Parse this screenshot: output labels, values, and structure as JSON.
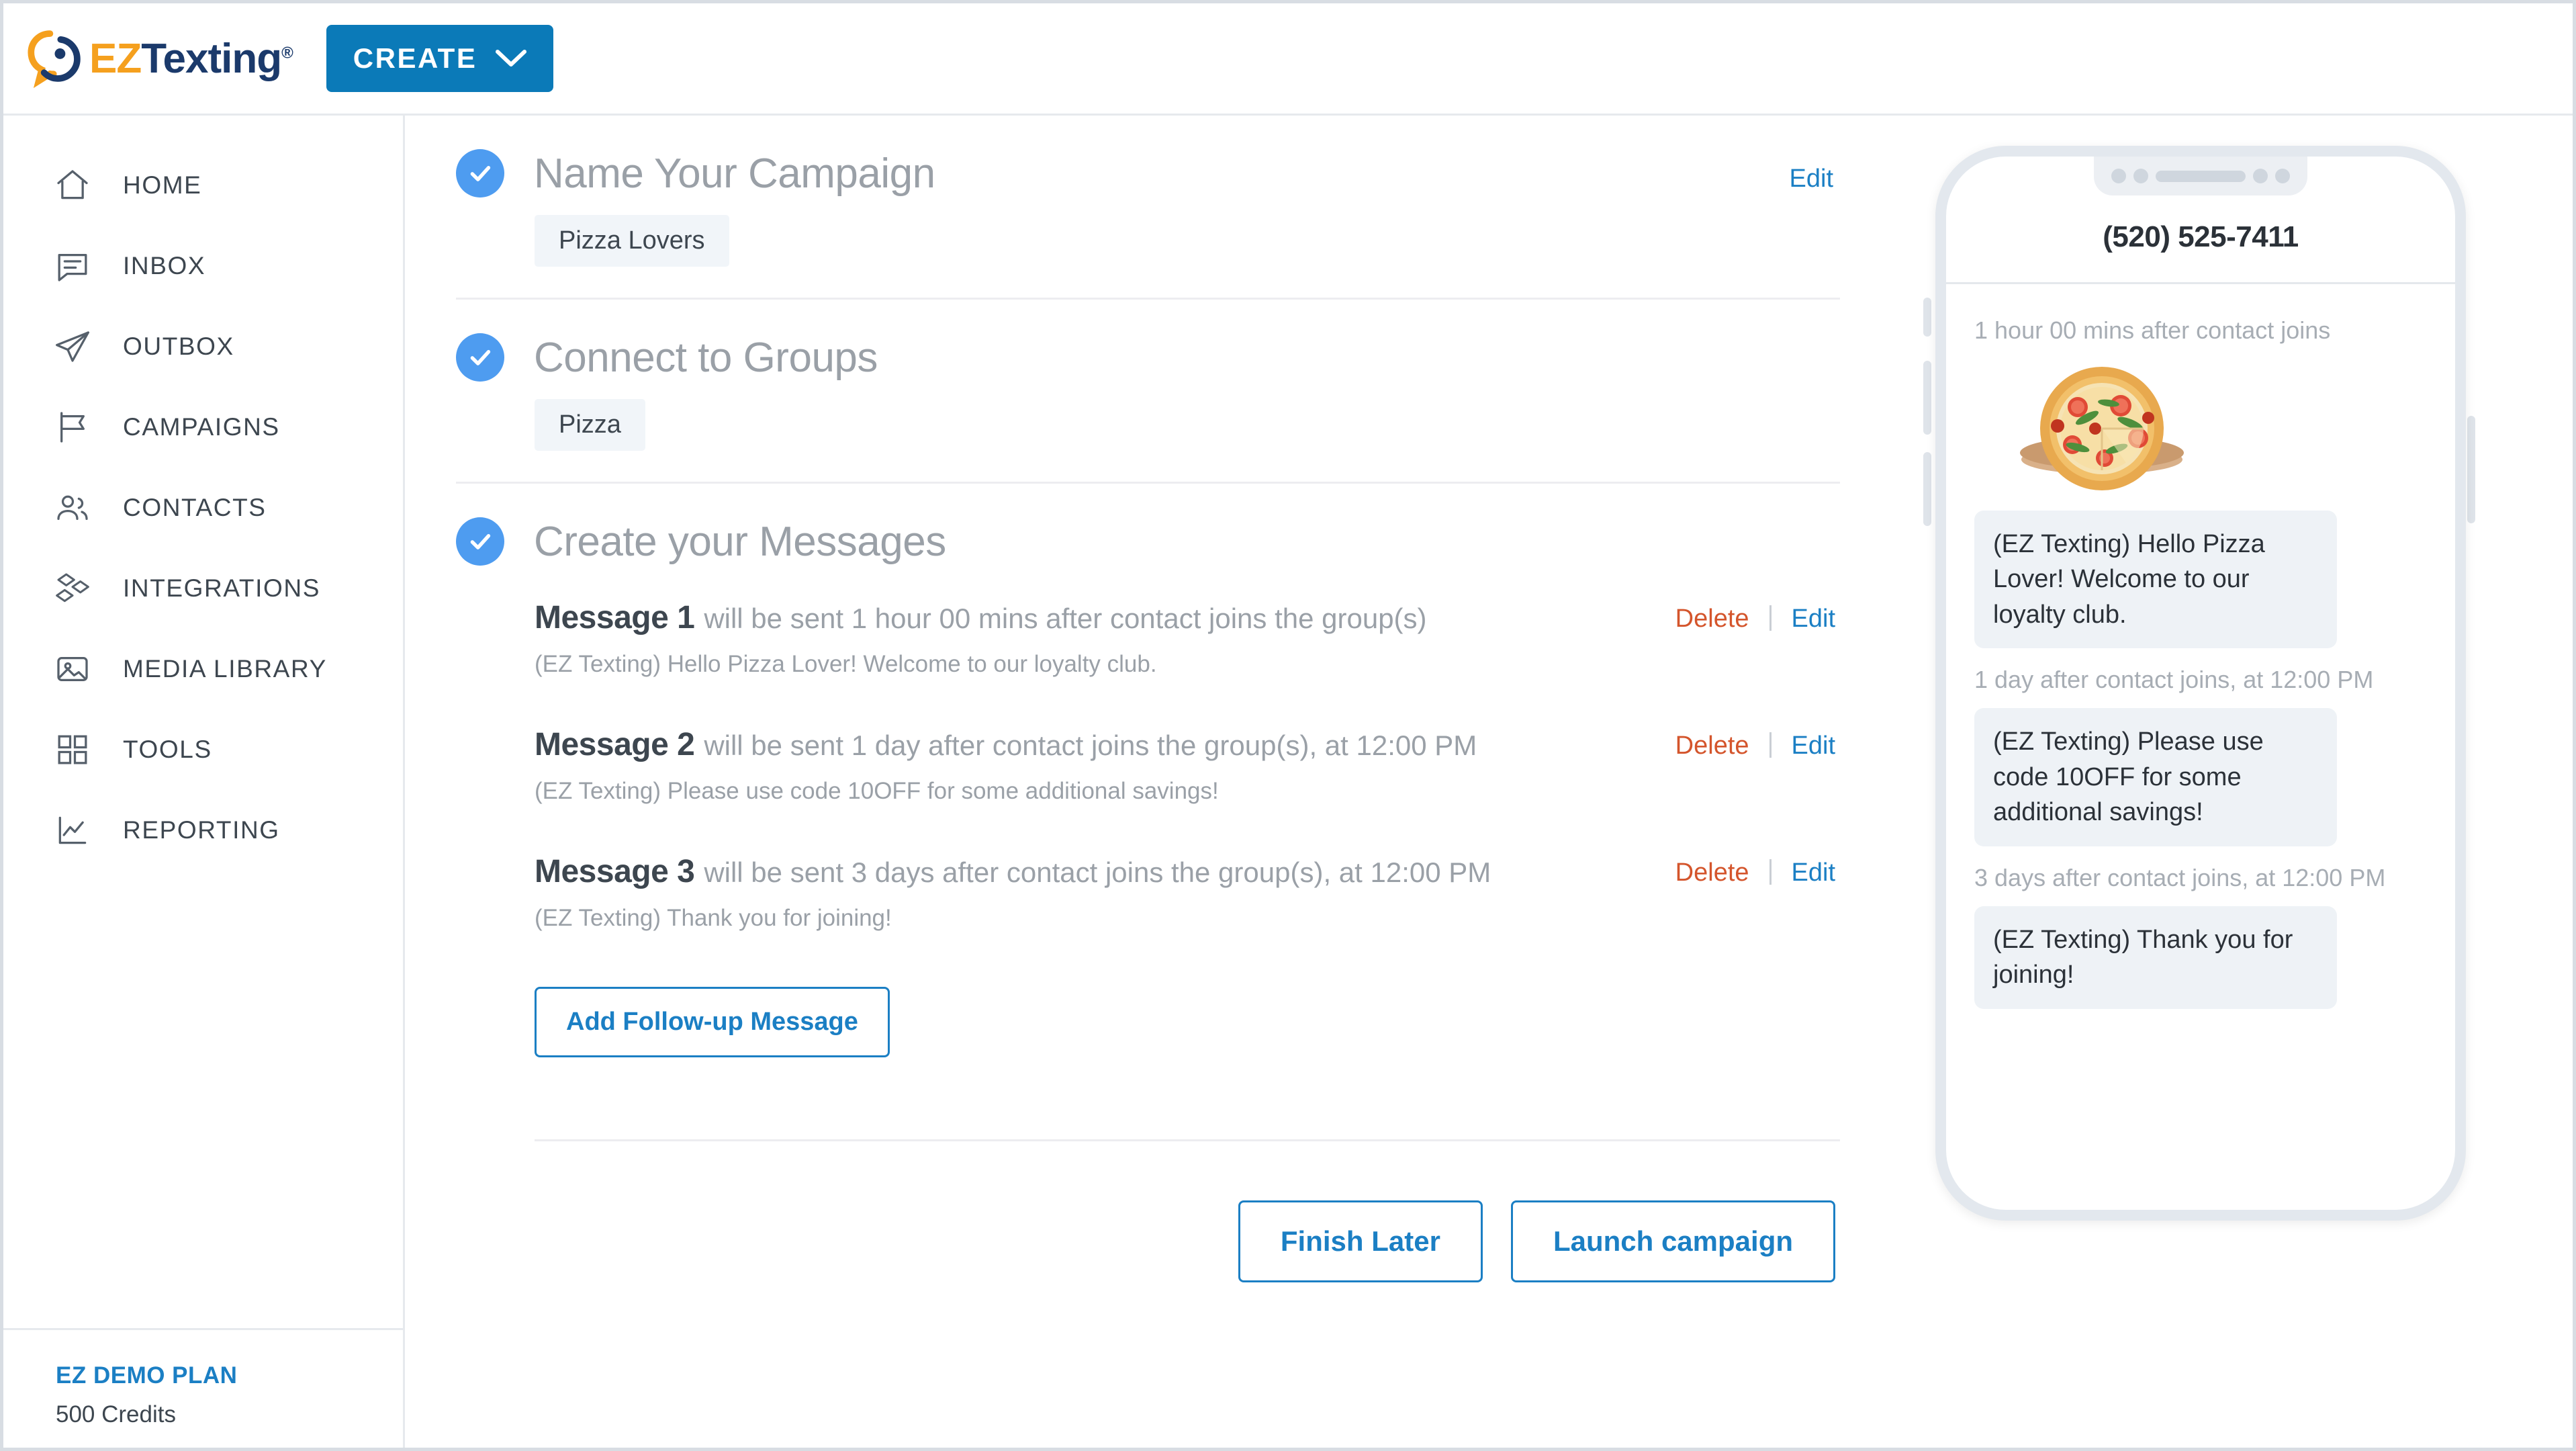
{
  "header": {
    "logo_ez": "EZ",
    "logo_texting": "Texting",
    "logo_reg": "®",
    "create_label": "CREATE"
  },
  "sidebar": {
    "items": [
      {
        "label": "HOME",
        "icon": "home-icon"
      },
      {
        "label": "INBOX",
        "icon": "chat-bubble-icon"
      },
      {
        "label": "OUTBOX",
        "icon": "paper-plane-icon"
      },
      {
        "label": "CAMPAIGNS",
        "icon": "flag-icon"
      },
      {
        "label": "CONTACTS",
        "icon": "people-icon"
      },
      {
        "label": "INTEGRATIONS",
        "icon": "diamonds-icon"
      },
      {
        "label": "MEDIA LIBRARY",
        "icon": "image-icon"
      },
      {
        "label": "TOOLS",
        "icon": "grid-icon"
      },
      {
        "label": "REPORTING",
        "icon": "line-chart-icon"
      }
    ],
    "plan_name": "EZ DEMO PLAN",
    "plan_credits": "500 Credits"
  },
  "main": {
    "section_name": {
      "title": "Name Your Campaign",
      "edit_label": "Edit",
      "chip": "Pizza Lovers"
    },
    "section_groups": {
      "title": "Connect to Groups",
      "chip": "Pizza"
    },
    "section_messages": {
      "title": "Create your Messages",
      "messages": [
        {
          "num": "Message 1",
          "when": "will be sent 1 hour 00 mins after contact joins the group(s)",
          "body": "(EZ Texting) Hello Pizza Lover! Welcome to our loyalty club.",
          "delete_label": "Delete",
          "edit_label": "Edit"
        },
        {
          "num": "Message 2",
          "when": "will be sent 1 day after contact joins the group(s), at 12:00 PM",
          "body": "(EZ Texting) Please use code 10OFF for some additional savings!",
          "delete_label": "Delete",
          "edit_label": "Edit"
        },
        {
          "num": "Message 3",
          "when": "will be sent 3 days after contact joins the group(s), at 12:00 PM",
          "body": "(EZ Texting) Thank you for joining!",
          "delete_label": "Delete",
          "edit_label": "Edit"
        }
      ],
      "add_followup_label": "Add Follow-up Message"
    },
    "finish_later_label": "Finish Later",
    "launch_label": "Launch campaign"
  },
  "preview": {
    "phone_number": "(520) 525-7411",
    "entries": [
      {
        "timestamp": "1 hour 00 mins after contact joins",
        "has_image": true,
        "image_alt": "pizza-photo",
        "text": "(EZ Texting) Hello Pizza Lover! Welcome to our loyalty club."
      },
      {
        "timestamp": "1 day after contact joins, at 12:00 PM",
        "has_image": false,
        "text": "(EZ Texting) Please use code 10OFF for some additional savings!"
      },
      {
        "timestamp": "3 days after contact joins, at 12:00 PM",
        "has_image": false,
        "text": "(EZ Texting) Thank you for joining!"
      }
    ]
  },
  "colors": {
    "brand_blue": "#0b7ab8",
    "link_blue": "#1b7fc4",
    "delete_red": "#d4552c",
    "logo_orange": "#f5a01e",
    "logo_navy": "#1b3a6b",
    "check_blue": "#4e9cf0",
    "chip_bg": "#f1f5f9",
    "bubble_bg": "#eef2f6"
  }
}
